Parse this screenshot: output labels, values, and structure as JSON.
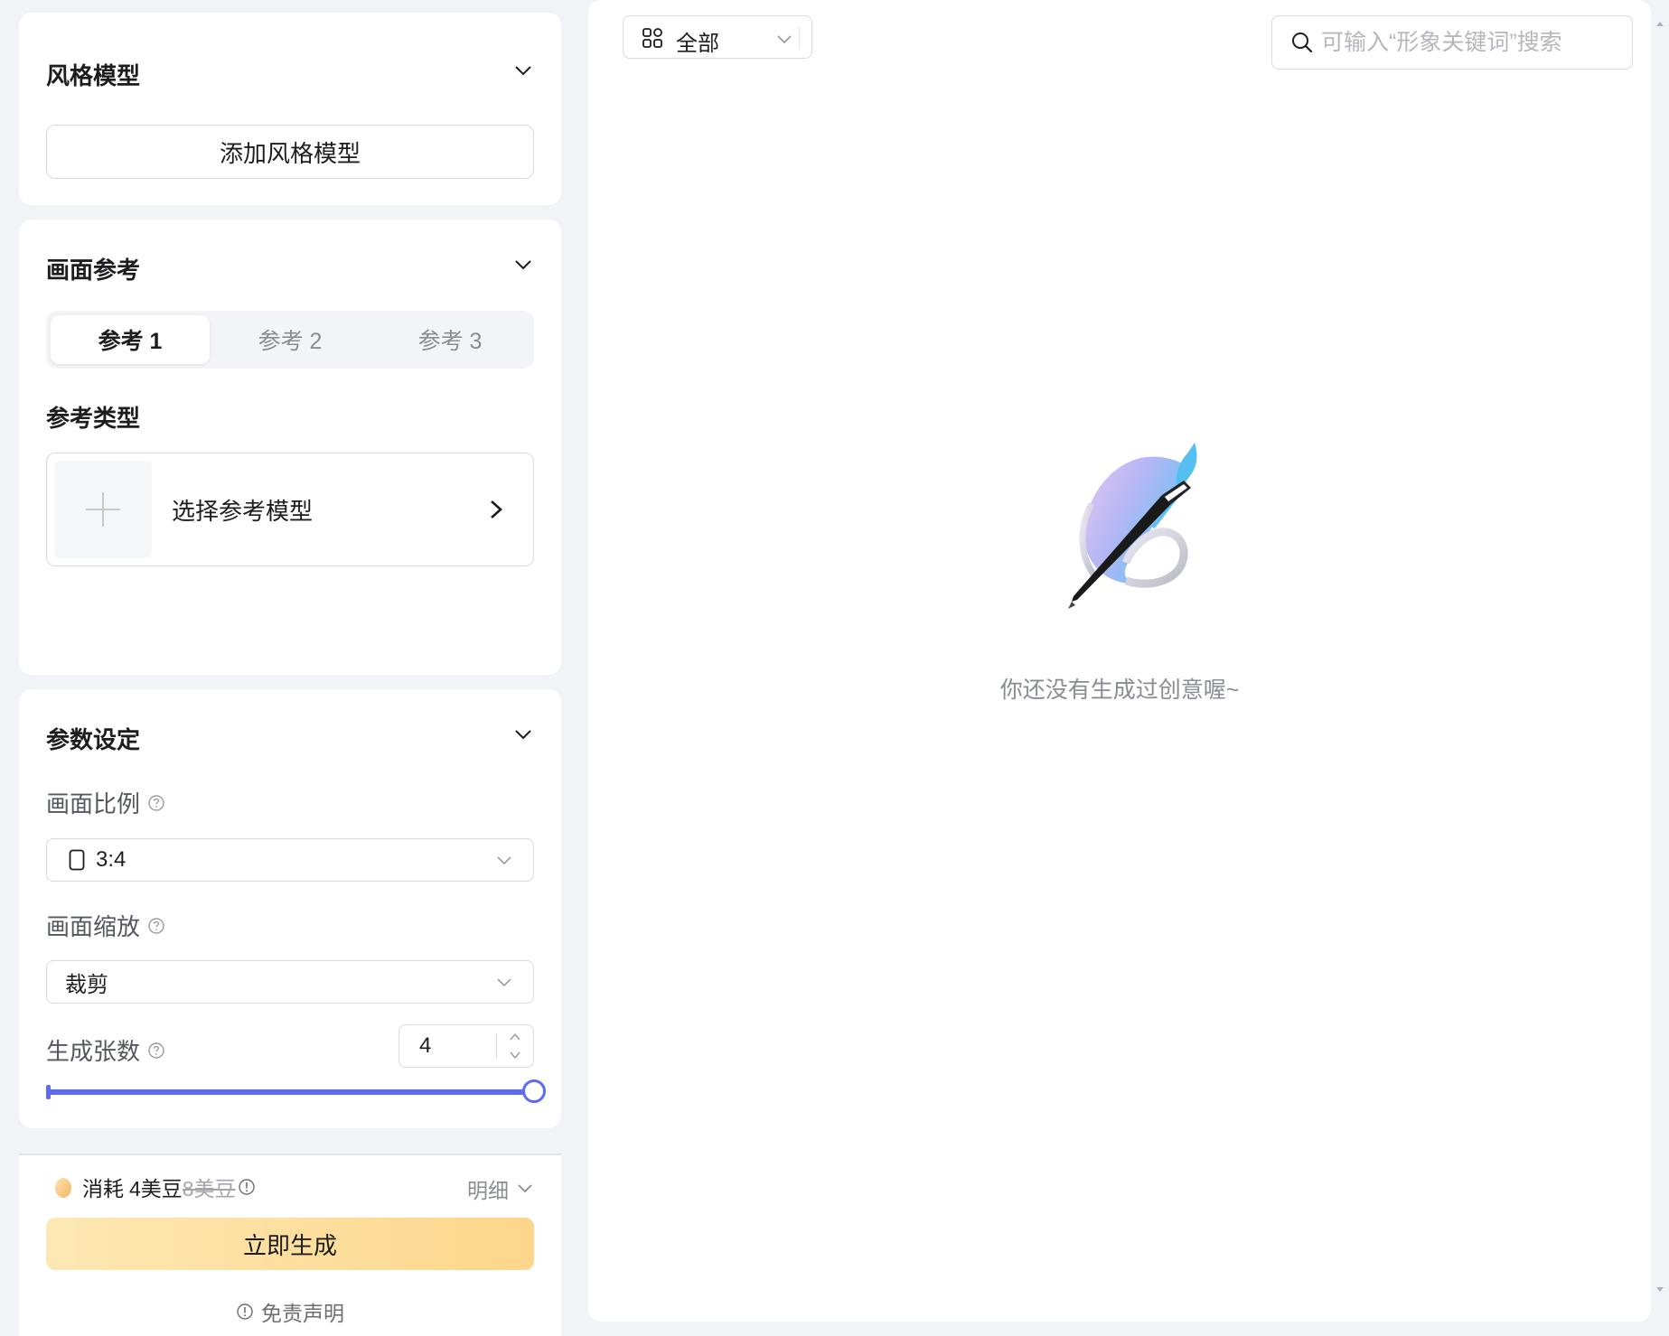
{
  "style_model": {
    "title": "风格模型",
    "add_button": "添加风格模型"
  },
  "reference": {
    "title": "画面参考",
    "tabs": [
      "参考 1",
      "参考 2",
      "参考 3"
    ],
    "active_tab": 0,
    "type_title": "参考类型",
    "picker_label": "选择参考模型"
  },
  "params": {
    "title": "参数设定",
    "ratio_label": "画面比例",
    "ratio_value": "3:4",
    "scale_label": "画面缩放",
    "scale_value": "裁剪",
    "count_label": "生成张数",
    "count_value": "4",
    "slider_fraction": 1.0
  },
  "footer": {
    "cost_label": "消耗",
    "cost_now": "4美豆",
    "cost_old": "8美豆",
    "detail_label": "明细",
    "generate_button": "立即生成",
    "disclaimer": "免责声明"
  },
  "main": {
    "filter_value": "全部",
    "search_placeholder": "可输入“形象关键词”搜索",
    "empty_text": "你还没有生成过创意喔~"
  },
  "colors": {
    "accent": "#5b6cf0",
    "generate_from": "#fde8b4",
    "generate_to": "#fdd68a"
  }
}
